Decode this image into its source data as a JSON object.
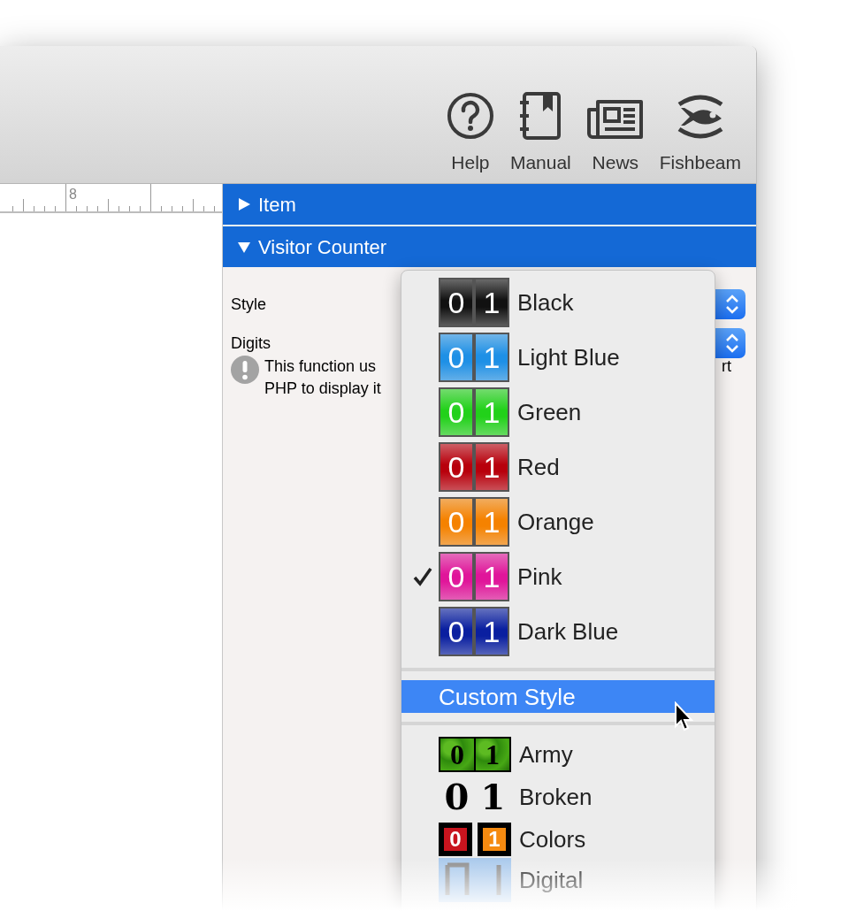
{
  "toolbar": {
    "buttons": [
      {
        "label": "Help",
        "kind": "help"
      },
      {
        "label": "Manual",
        "kind": "manual"
      },
      {
        "label": "News",
        "kind": "news"
      },
      {
        "label": "Fishbeam",
        "kind": "fish"
      }
    ]
  },
  "ruler": {
    "label": "8"
  },
  "inspector": {
    "sections": [
      {
        "title": "Item",
        "expanded": false
      },
      {
        "title": "Visitor Counter",
        "expanded": true
      }
    ],
    "fields": [
      {
        "label": "Style"
      },
      {
        "label": "Digits"
      }
    ],
    "note": {
      "lines": [
        "This function us",
        "PHP to display it"
      ],
      "tail": "rt"
    }
  },
  "menu": {
    "items": [
      {
        "kind": "tiles",
        "label": "Black",
        "color": "#111111",
        "selected": false,
        "highlighted": false,
        "digits": [
          "0",
          "1"
        ]
      },
      {
        "kind": "tiles",
        "label": "Light Blue",
        "color": "#1e90e6",
        "selected": false,
        "highlighted": false,
        "digits": [
          "0",
          "1"
        ]
      },
      {
        "kind": "tiles",
        "label": "Green",
        "color": "#22d11a",
        "selected": false,
        "highlighted": false,
        "digits": [
          "0",
          "1"
        ]
      },
      {
        "kind": "tiles",
        "label": "Red",
        "color": "#b8000c",
        "selected": false,
        "highlighted": false,
        "digits": [
          "0",
          "1"
        ]
      },
      {
        "kind": "tiles",
        "label": "Orange",
        "color": "#f58200",
        "selected": false,
        "highlighted": false,
        "digits": [
          "0",
          "1"
        ]
      },
      {
        "kind": "tiles",
        "label": "Pink",
        "color": "#e0159a",
        "selected": true,
        "highlighted": false,
        "digits": [
          "0",
          "1"
        ]
      },
      {
        "kind": "tiles",
        "label": "Dark Blue",
        "color": "#0a1fa0",
        "selected": false,
        "highlighted": false,
        "digits": [
          "0",
          "1"
        ]
      },
      {
        "kind": "separator"
      },
      {
        "kind": "action",
        "label": "Custom Style",
        "selected": false,
        "highlighted": true
      },
      {
        "kind": "separator"
      },
      {
        "kind": "army",
        "label": "Army",
        "selected": false,
        "highlighted": false,
        "digits": [
          "0",
          "1"
        ]
      },
      {
        "kind": "broken",
        "label": "Broken",
        "selected": false,
        "highlighted": false,
        "digits": [
          "0",
          "1"
        ]
      },
      {
        "kind": "blocks",
        "label": "Colors",
        "selected": false,
        "highlighted": false,
        "digits": [
          "0",
          "1"
        ]
      },
      {
        "kind": "digital",
        "label": "Digital",
        "selected": false,
        "highlighted": false
      }
    ]
  }
}
